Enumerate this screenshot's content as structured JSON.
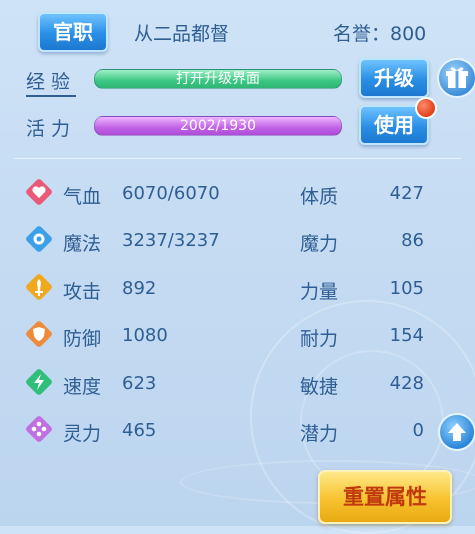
{
  "header": {
    "rank_button": "官职",
    "rank_title": "从二品都督",
    "honor": "名誉：800"
  },
  "progress": {
    "exp_label": "经验",
    "exp_bar_text": "打开升级界面",
    "upgrade_button": "升级",
    "vit_label": "活力",
    "vit_bar_text": "2002/1930",
    "use_button": "使用"
  },
  "stats": [
    {
      "name": "气血",
      "value": "6070/6070",
      "icon": "heart-icon",
      "color": "#e85a78"
    },
    {
      "name": "魔法",
      "value": "3237/3237",
      "icon": "mana-icon",
      "color": "#3d9fe8"
    },
    {
      "name": "攻击",
      "value": "892",
      "icon": "sword-icon",
      "color": "#f0a81e"
    },
    {
      "name": "防御",
      "value": "1080",
      "icon": "shield-icon",
      "color": "#ef8a3a"
    },
    {
      "name": "速度",
      "value": "623",
      "icon": "lightning-icon",
      "color": "#2fbf7a"
    },
    {
      "name": "灵力",
      "value": "465",
      "icon": "spirit-icon",
      "color": "#c070e0"
    }
  ],
  "attributes": [
    {
      "name": "体质",
      "value": "427"
    },
    {
      "name": "魔力",
      "value": "86"
    },
    {
      "name": "力量",
      "value": "105"
    },
    {
      "name": "耐力",
      "value": "154"
    },
    {
      "name": "敏捷",
      "value": "428"
    },
    {
      "name": "潜力",
      "value": "0"
    }
  ],
  "footer": {
    "reset_button": "重置属性"
  }
}
